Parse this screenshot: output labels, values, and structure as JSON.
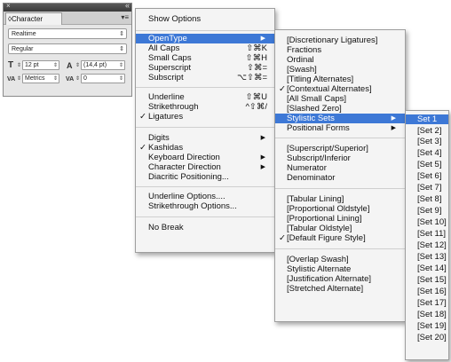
{
  "panel": {
    "close_glyph": "×",
    "collapse_glyph": "«",
    "tab_title": "◊Character",
    "menu_glyph": "▾≡",
    "font_family": "Realtime",
    "font_style": "Regular",
    "dropdown_arrow": "⇕",
    "font_size": "12 pt",
    "leading": "(14,4 pt)",
    "kerning": "Metrics",
    "tracking": "0",
    "icons": {
      "size": "T",
      "leading": "A",
      "kerning": "VA",
      "tracking": "VA"
    }
  },
  "menu1": {
    "items": [
      {
        "label": "Show Options"
      },
      {
        "label": "OpenType",
        "arrow": "▶",
        "selected": true
      },
      {
        "label": "All Caps",
        "shortcut": "⇧⌘K"
      },
      {
        "label": "Small Caps",
        "shortcut": "⇧⌘H"
      },
      {
        "label": "Superscript",
        "shortcut": "⇧⌘="
      },
      {
        "label": "Subscript",
        "shortcut": "⌥⇧⌘="
      },
      {
        "label": "Underline",
        "shortcut": "⇧⌘U"
      },
      {
        "label": "Strikethrough",
        "shortcut": "^⇧⌘/"
      },
      {
        "label": "Ligatures",
        "check": "✓"
      },
      {
        "label": "Digits",
        "arrow": "▶"
      },
      {
        "label": "Kashidas",
        "check": "✓"
      },
      {
        "label": "Keyboard Direction",
        "arrow": "▶"
      },
      {
        "label": "Character Direction",
        "arrow": "▶"
      },
      {
        "label": "Diacritic Positioning..."
      },
      {
        "label": "Underline Options...."
      },
      {
        "label": "Strikethrough Options..."
      },
      {
        "label": "No Break"
      }
    ]
  },
  "menu2": {
    "items": [
      {
        "label": "[Discretionary Ligatures]"
      },
      {
        "label": "Fractions"
      },
      {
        "label": "Ordinal"
      },
      {
        "label": "[Swash]"
      },
      {
        "label": "[Titling Alternates]"
      },
      {
        "label": "[Contextual Alternates]",
        "check": "✓"
      },
      {
        "label": "[All Small Caps]"
      },
      {
        "label": "[Slashed Zero]"
      },
      {
        "label": "Stylistic Sets",
        "arrow": "▶",
        "selected": true
      },
      {
        "label": "Positional Forms",
        "arrow": "▶"
      },
      {
        "label": "[Superscript/Superior]"
      },
      {
        "label": "Subscript/Inferior"
      },
      {
        "label": "Numerator"
      },
      {
        "label": "Denominator"
      },
      {
        "label": "[Tabular Lining]"
      },
      {
        "label": "[Proportional Oldstyle]"
      },
      {
        "label": "[Proportional Lining]"
      },
      {
        "label": "[Tabular Oldstyle]"
      },
      {
        "label": "[Default Figure Style]",
        "check": "✓"
      },
      {
        "label": "[Overlap Swash]"
      },
      {
        "label": "Stylistic Alternate"
      },
      {
        "label": "[Justification Alternate]"
      },
      {
        "label": "[Stretched Alternate]"
      }
    ]
  },
  "menu3": {
    "items": [
      {
        "label": "Set 1",
        "selected": true
      },
      {
        "label": "[Set 2]"
      },
      {
        "label": "[Set 3]"
      },
      {
        "label": "[Set 4]"
      },
      {
        "label": "[Set 5]"
      },
      {
        "label": "[Set 6]"
      },
      {
        "label": "[Set 7]"
      },
      {
        "label": "[Set 8]"
      },
      {
        "label": "[Set 9]"
      },
      {
        "label": "[Set 10]"
      },
      {
        "label": "[Set 11]"
      },
      {
        "label": "[Set 12]"
      },
      {
        "label": "[Set 13]"
      },
      {
        "label": "[Set 14]"
      },
      {
        "label": "[Set 15]"
      },
      {
        "label": "[Set 16]"
      },
      {
        "label": "[Set 17]"
      },
      {
        "label": "[Set 18]"
      },
      {
        "label": "[Set 19]"
      },
      {
        "label": "[Set 20]"
      }
    ]
  },
  "colors": {
    "selection": "#3d78d6",
    "menu_bg": "#f4f4f4",
    "panel_bg": "#e6e6e6"
  }
}
